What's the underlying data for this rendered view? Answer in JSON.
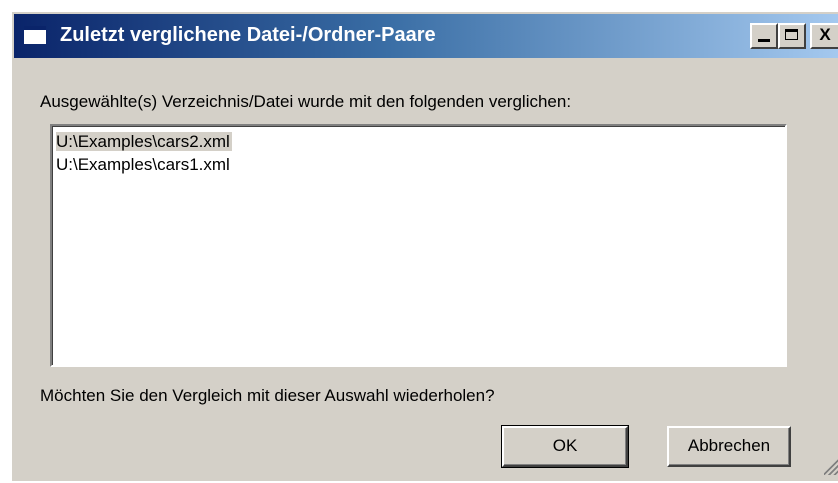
{
  "window": {
    "title": "Zuletzt verglichene Datei-/Ordner-Paare",
    "controls": {
      "minimize": "_",
      "maximize": "□",
      "close": "X"
    }
  },
  "dialog": {
    "prompt": "Ausgewählte(s) Verzeichnis/Datei wurde mit den folgenden verglichen:",
    "items": [
      {
        "label": "U:\\Examples\\cars2.xml",
        "selected": true
      },
      {
        "label": "U:\\Examples\\cars1.xml",
        "selected": false
      }
    ],
    "question": "Möchten Sie den Vergleich mit dieser Auswahl wiederholen?",
    "ok_label": "OK",
    "cancel_label": "Abbrechen"
  },
  "colors": {
    "title_gradient_start": "#0a246a",
    "title_gradient_end": "#a6caf0",
    "face": "#d4d0c8"
  },
  "icons": {
    "window": "window-icon",
    "resize": "resize-grip-icon"
  }
}
